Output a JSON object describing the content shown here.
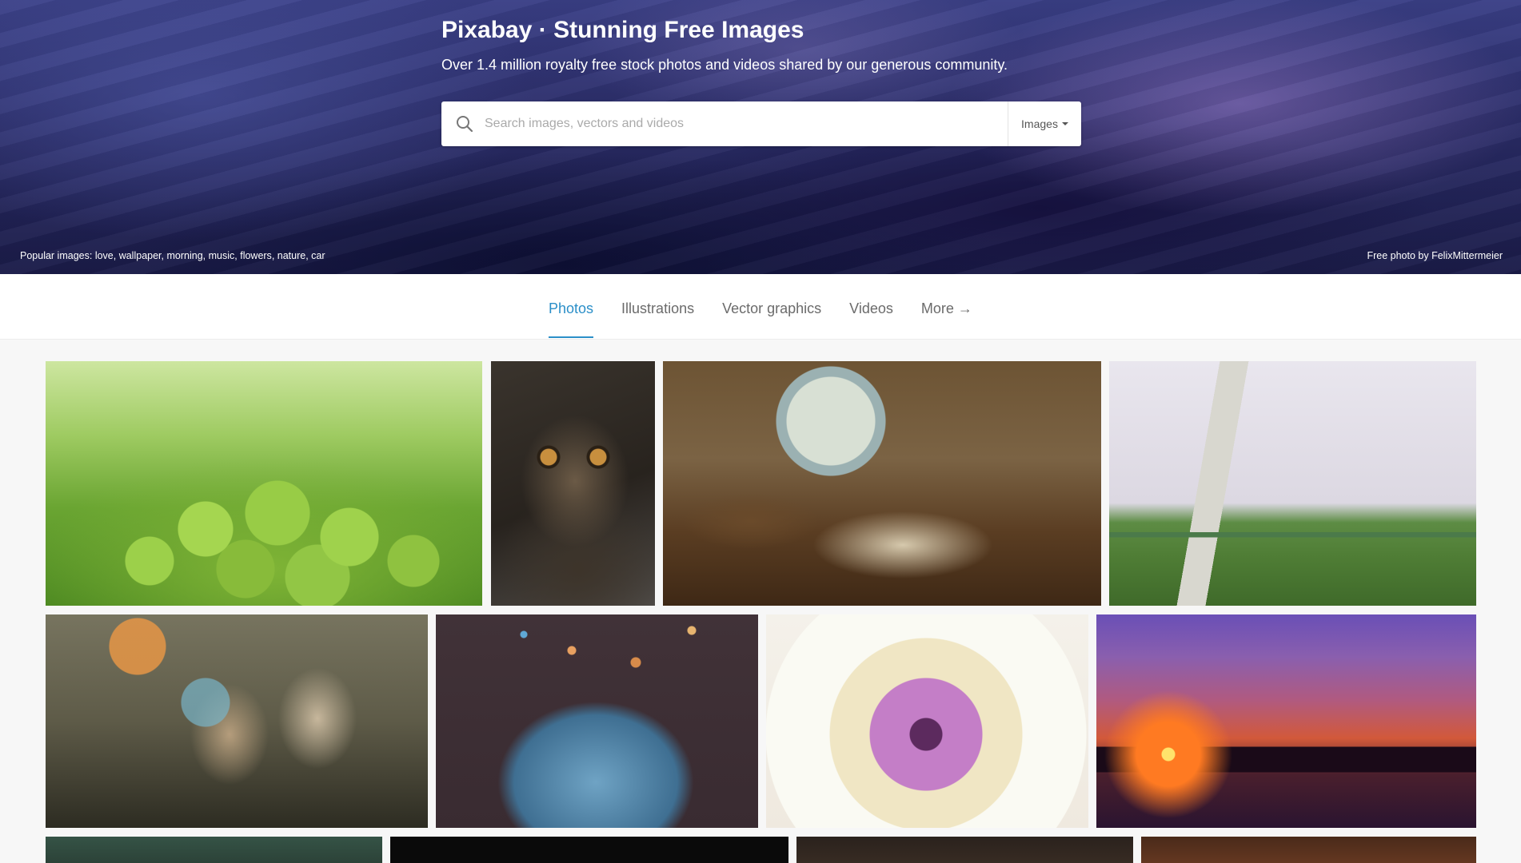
{
  "hero": {
    "title": "Pixabay · Stunning Free Images",
    "subtitle": "Over 1.4 million royalty free stock photos and videos shared by our generous community.",
    "search": {
      "placeholder": "Search images, vectors and videos",
      "value": "",
      "type_label": "Images",
      "icon": "search-icon"
    },
    "popular": {
      "label": "Popular images:",
      "tags": [
        "love",
        "wallpaper",
        "morning",
        "music",
        "flowers",
        "nature",
        "car"
      ]
    },
    "credit": {
      "prefix": "Free photo by",
      "author": "FelixMittermeier"
    }
  },
  "tabs": [
    {
      "label": "Photos",
      "active": true
    },
    {
      "label": "Illustrations",
      "active": false
    },
    {
      "label": "Vector graphics",
      "active": false
    },
    {
      "label": "Videos",
      "active": false
    },
    {
      "label": "More →",
      "active": false
    }
  ],
  "colors": {
    "accent": "#2b8fc8",
    "tab_inactive": "#6b6b6b",
    "page_bg": "#f7f7f7"
  }
}
